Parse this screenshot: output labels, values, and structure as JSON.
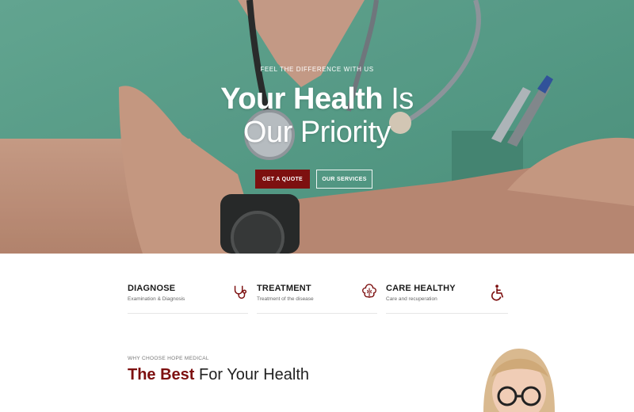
{
  "hero": {
    "eyebrow": "FEEL THE DIFFERENCE WITH US",
    "headline_bold": "Your Health",
    "headline_light_1": "Is",
    "headline_line2": "Our Priority",
    "primary_button": "GET A QUOTE",
    "secondary_button": "OUR SERVICES",
    "colors": {
      "accent": "#7d1010",
      "scrubs": "#5fa58f"
    }
  },
  "features": [
    {
      "title": "DIAGNOSE",
      "subtitle": "Examination & Diagnosis",
      "icon": "stethoscope-icon"
    },
    {
      "title": "TREATMENT",
      "subtitle": "Treatment of the disease",
      "icon": "brain-icon"
    },
    {
      "title": "CARE HEALTHY",
      "subtitle": "Care and recuperation",
      "icon": "wheelchair-icon"
    }
  ],
  "why": {
    "eyebrow": "WHY CHOOSE HOPE MEDICAL",
    "title_accent": "The Best",
    "title_rest": "For Your Health"
  }
}
